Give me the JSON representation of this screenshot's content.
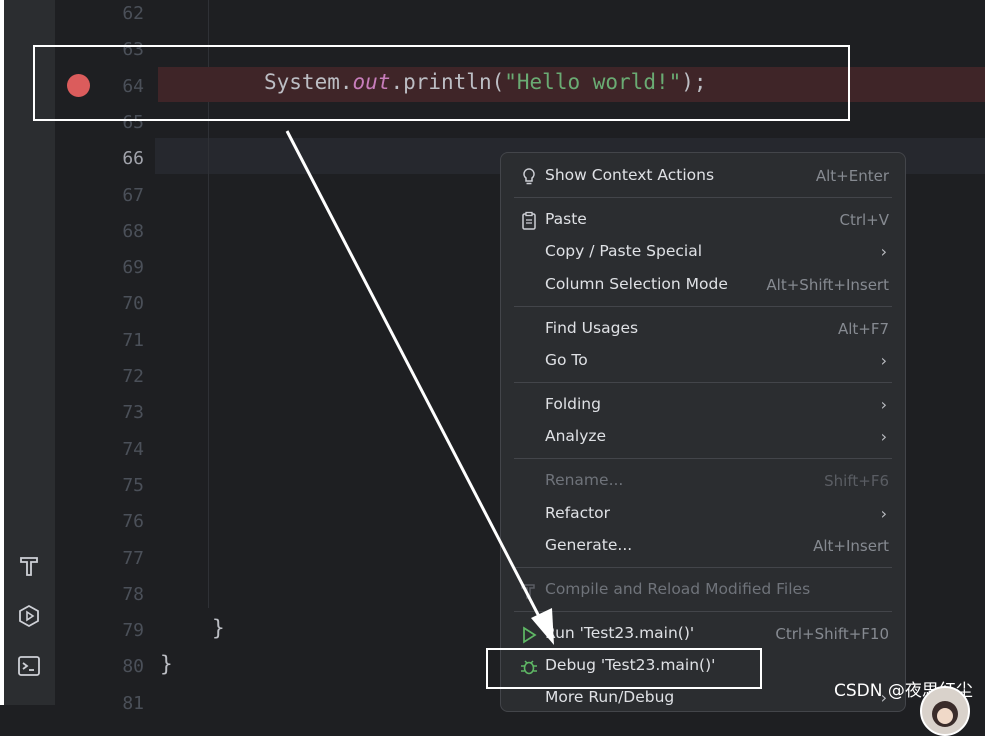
{
  "editor": {
    "line_numbers": [
      "62",
      "63",
      "64",
      "65",
      "66",
      "67",
      "68",
      "69",
      "70",
      "71",
      "72",
      "73",
      "74",
      "75",
      "76",
      "77",
      "78",
      "79",
      "80",
      "81"
    ],
    "current_line": "66",
    "code": {
      "prefix": "System.",
      "field": "out",
      "method": ".println(",
      "string": "\"Hello world!\"",
      "suffix": ");"
    },
    "brace_inner": "}",
    "brace_outer": "}"
  },
  "toolbar_left": {
    "icons": [
      "build-icon",
      "run-services-icon",
      "terminal-icon"
    ]
  },
  "context_menu": {
    "items": [
      {
        "label": "Show Context Actions",
        "shortcut": "Alt+Enter",
        "icon": "lightbulb-icon"
      },
      {
        "label": "Paste",
        "shortcut": "Ctrl+V",
        "icon": "clipboard-icon"
      },
      {
        "label": "Copy / Paste Special",
        "submenu": true
      },
      {
        "label": "Column Selection Mode",
        "shortcut": "Alt+Shift+Insert"
      },
      {
        "label": "Find Usages",
        "shortcut": "Alt+F7"
      },
      {
        "label": "Go To",
        "submenu": true
      },
      {
        "label": "Folding",
        "submenu": true
      },
      {
        "label": "Analyze",
        "submenu": true
      },
      {
        "label": "Rename...",
        "shortcut": "Shift+F6",
        "disabled": true
      },
      {
        "label": "Refactor",
        "submenu": true
      },
      {
        "label": "Generate...",
        "shortcut": "Alt+Insert"
      },
      {
        "label": "Compile and Reload Modified Files",
        "disabled": true,
        "icon": "hammer-icon"
      },
      {
        "label": "Run 'Test23.main()'",
        "shortcut": "Ctrl+Shift+F10",
        "icon": "play-icon"
      },
      {
        "label": "Debug 'Test23.main()'",
        "icon": "bug-icon"
      },
      {
        "label": "More Run/Debug",
        "submenu": true
      }
    ]
  },
  "watermark": "CSDN @夜思红尘",
  "colors": {
    "background": "#1e1f22",
    "breakpoint": "#db5c5c",
    "breakpoint_line": "#3f2528",
    "string": "#6aab73",
    "field": "#c77dbb",
    "run_green": "#5fb865",
    "annotation": "#ffffff"
  }
}
